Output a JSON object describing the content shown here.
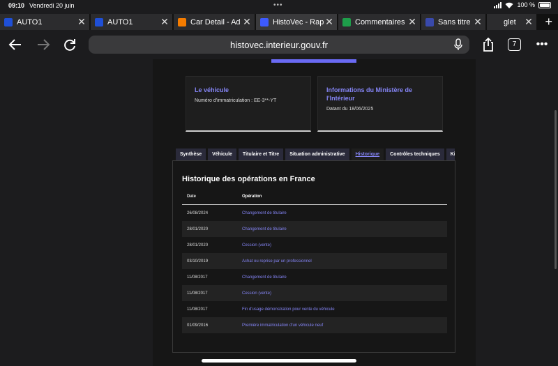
{
  "status": {
    "time": "09:10",
    "date": "Vendredi 20 juin",
    "battery": "100 %"
  },
  "tabs": [
    {
      "title": "AUTO1",
      "favicon_color": "#1f4fd6",
      "active": false
    },
    {
      "title": "AUTO1",
      "favicon_color": "#1f4fd6",
      "active": false
    },
    {
      "title": "Car Detail - Ad",
      "favicon_color": "#f57c00",
      "active": false
    },
    {
      "title": "HistoVec - Rap",
      "favicon_color": "#3d5afe",
      "active": true
    },
    {
      "title": "Commentaires",
      "favicon_color": "#1e9e4a",
      "active": false
    },
    {
      "title": "Sans titre",
      "favicon_color": "#3949ab",
      "active": false
    },
    {
      "title": "glet",
      "favicon_color": "#2c2c2e",
      "active": false
    }
  ],
  "toolbar": {
    "url": "histovec.interieur.gouv.fr",
    "tab_count": "7"
  },
  "cards": {
    "vehicle": {
      "title": "Le véhicule",
      "text": "Numéro d'immatriculation : EE-3**-YT"
    },
    "ministry": {
      "title": "Informations du Ministère de l'Intérieur",
      "text": "Datant du 18/06/2025"
    }
  },
  "nav_tabs": [
    "Synthèse",
    "Véhicule",
    "Titulaire et Titre",
    "Situation administrative",
    "Historique",
    "Contrôles techniques",
    "Kilo"
  ],
  "active_nav_tab": "Historique",
  "history": {
    "title": "Historique des opérations en France",
    "headers": {
      "date": "Date",
      "operation": "Opération"
    },
    "rows": [
      {
        "date": "26/08/2024",
        "operation": "Changement de titulaire"
      },
      {
        "date": "28/01/2020",
        "operation": "Changement de titulaire"
      },
      {
        "date": "28/01/2020",
        "operation": "Cession (vente)"
      },
      {
        "date": "03/10/2019",
        "operation": "Achat ou reprise par un professionnel"
      },
      {
        "date": "11/08/2017",
        "operation": "Changement de titulaire"
      },
      {
        "date": "11/08/2017",
        "operation": "Cession (vente)"
      },
      {
        "date": "11/08/2017",
        "operation": "Fin d'usage démonstration pour vente du véhicule"
      },
      {
        "date": "01/09/2016",
        "operation": "Première immatriculation d'un véhicule neuf"
      }
    ]
  },
  "colors": {
    "accent": "#8585f6",
    "button": "#6a6af4"
  }
}
